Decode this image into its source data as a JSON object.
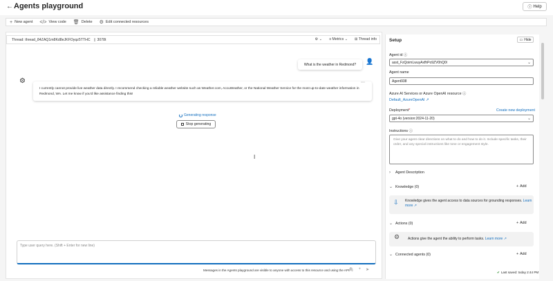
{
  "header": {
    "back_icon": "arrow-left-icon",
    "title": "Agents playground",
    "help_label": "Help"
  },
  "toolbar": {
    "new_agent": "New agent",
    "view_code": "View code",
    "delete": "Delete",
    "edit_resources": "Edit connected resources"
  },
  "thread": {
    "label": "Thread: thread_84ZAQ1m8Kd8eJKFOyqz5TTHC",
    "tokens": "3078t",
    "metrics": "Metrics",
    "thread_info": "Thread info"
  },
  "chat": {
    "user_message": "What is the weather in Redmond?",
    "bot_message": "I currently cannot provide live weather data directly. I recommend checking a reliable weather website such as Weather.com, AccuWeather, or the National Weather Service for the most up-to-date weather information in Redmond, WA. Let me know if you'd like assistance finding this!",
    "generating": "Generating response",
    "stop_label": "Stop generating",
    "input_placeholder": "Type user query here. (Shift + Enter for new line)",
    "footnote": "Messages in the Agents playground are visible to anyone with access to this resource and using the API."
  },
  "setup": {
    "title": "Setup",
    "hide": "Hide",
    "agent_id_label": "Agent id",
    "agent_id_value": "asst_FzQoimLwuyAxfhPo9ZV0hQ0l",
    "agent_name_label": "Agent name",
    "agent_name_value": "Agent938",
    "azure_label": "Azure AI Services or Azure OpenAI resource",
    "azure_link": "Default_AzureOpenAI",
    "deployment_label": "Deployment",
    "deployment_required": "*",
    "create_deployment": "Create new deployment",
    "deployment_value": "gpt-4o (version:2024-11-20)",
    "instructions_label": "Instructions",
    "instructions_placeholder": "Give your agent clear directions on what to do and how to do it. Include specific tasks, their order, and any special instructions like tone or engagement style.",
    "agent_description": "Agent Description",
    "knowledge": "Knowledge (0)",
    "knowledge_text": "Knowledge gives the agent access to data sources for grounding responses.",
    "learn_more": "Learn more",
    "actions": "Actions (0)",
    "actions_text": "Actions give the agent the ability to perform tasks.",
    "connected_agents": "Connected agents (0)",
    "add": "Add",
    "saved": "Last saved: today 2:44 PM"
  }
}
